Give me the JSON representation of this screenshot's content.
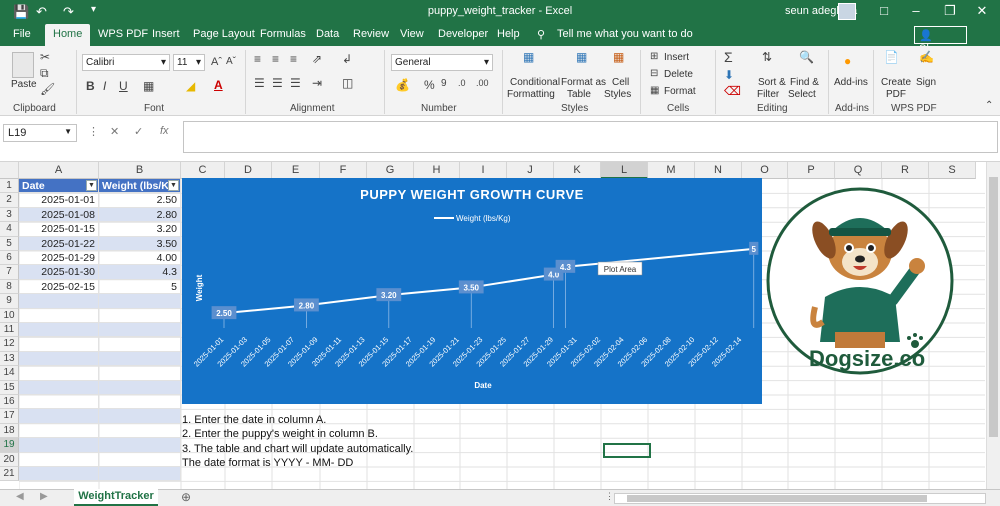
{
  "titlebar": {
    "title": "puppy_weight_tracker - Excel",
    "user": "seun adegbola",
    "save_icon": "save-icon",
    "undo_icon": "undo-icon",
    "redo_icon": "redo-icon"
  },
  "tabs": [
    "File",
    "Home",
    "WPS PDF",
    "Insert",
    "Page Layout",
    "Formulas",
    "Data",
    "Review",
    "View",
    "Developer",
    "Help"
  ],
  "tell_me": "Tell me what you want to do",
  "share_label": "Share",
  "ribbon": {
    "clipboard": {
      "paste": "Paste",
      "label": "Clipboard"
    },
    "font": {
      "name": "Calibri",
      "size": "11",
      "label": "Font",
      "bold": "B",
      "italic": "I",
      "underline": "U"
    },
    "alignment": {
      "label": "Alignment"
    },
    "number": {
      "format": "General",
      "label": "Number",
      "percent": "%"
    },
    "styles": {
      "conditional": "Conditional",
      "formatting": "Formatting",
      "format_as": "Format as",
      "table": "Table",
      "cell": "Cell",
      "styles_word": "Styles",
      "label": "Styles"
    },
    "cells": {
      "insert": "Insert",
      "delete": "Delete",
      "format": "Format",
      "label": "Cells"
    },
    "editing": {
      "sort": "Sort &",
      "filter": "Filter",
      "find": "Find &",
      "select": "Select",
      "label": "Editing",
      "sigma": "Σ"
    },
    "addins": {
      "addins": "Add-ins",
      "label": "Add-ins"
    },
    "wps": {
      "create": "Create",
      "pdf": "PDF",
      "sign": "Sign",
      "label": "WPS PDF"
    }
  },
  "formula_bar": {
    "cell_ref": "L19",
    "formula": ""
  },
  "columns": [
    "A",
    "B",
    "C",
    "D",
    "E",
    "F",
    "G",
    "H",
    "I",
    "J",
    "K",
    "L",
    "M",
    "N",
    "O",
    "P",
    "Q",
    "R",
    "S"
  ],
  "rows": [
    "1",
    "2",
    "3",
    "4",
    "5",
    "6",
    "7",
    "8",
    "9",
    "10",
    "11",
    "12",
    "13",
    "14",
    "15",
    "16",
    "17",
    "18",
    "19",
    "20",
    "21"
  ],
  "table": {
    "headers": [
      "Date",
      "Weight (lbs/Kg"
    ],
    "rows": [
      [
        "2025-01-01",
        "2.50"
      ],
      [
        "2025-01-08",
        "2.80"
      ],
      [
        "2025-01-15",
        "3.20"
      ],
      [
        "2025-01-22",
        "3.50"
      ],
      [
        "2025-01-29",
        "4.00"
      ],
      [
        "2025-01-30",
        "4.3"
      ],
      [
        "2025-02-15",
        "5"
      ]
    ]
  },
  "chart_data": {
    "type": "line",
    "title": "PUPPY WEIGHT GROWTH CURVE",
    "legend": "Weight (lbs/Kg)",
    "legend_position": "top",
    "xlabel": "Date",
    "ylabel": "Weight",
    "x": [
      "2025-01-01",
      "2025-01-08",
      "2025-01-15",
      "2025-01-22",
      "2025-01-29",
      "2025-01-30",
      "2025-02-15"
    ],
    "y": [
      2.5,
      2.8,
      3.2,
      3.5,
      4.0,
      4.3,
      5
    ],
    "data_labels": [
      "2.50",
      "2.80",
      "3.20",
      "3.50",
      "4.0",
      "4.3",
      "5"
    ],
    "x_ticks": [
      "2025-01-01",
      "2025-01-03",
      "2025-01-05",
      "2025-01-07",
      "2025-01-09",
      "2025-01-11",
      "2025-01-13",
      "2025-01-15",
      "2025-01-17",
      "2025-01-19",
      "2025-01-21",
      "2025-01-23",
      "2025-01-25",
      "2025-01-27",
      "2025-01-29",
      "2025-01-31",
      "2025-02-02",
      "2025-02-04",
      "2025-02-06",
      "2025-02-08",
      "2025-02-10",
      "2025-02-12",
      "2025-02-14"
    ],
    "tooltip": "Plot Area",
    "background": "#1573c8",
    "line_color": "#ffffff"
  },
  "logo": {
    "text": "Dogsize",
    "suffix": ".co",
    "color": "#1f5b3c"
  },
  "notes": [
    "1. Enter the date in column A.",
    "2. Enter the puppy's weight in column B.",
    "3. The table and chart will update automatically.",
    "The date format is YYYY - MM- DD"
  ],
  "sheet_tab": "WeightTracker",
  "accent": "#217346"
}
